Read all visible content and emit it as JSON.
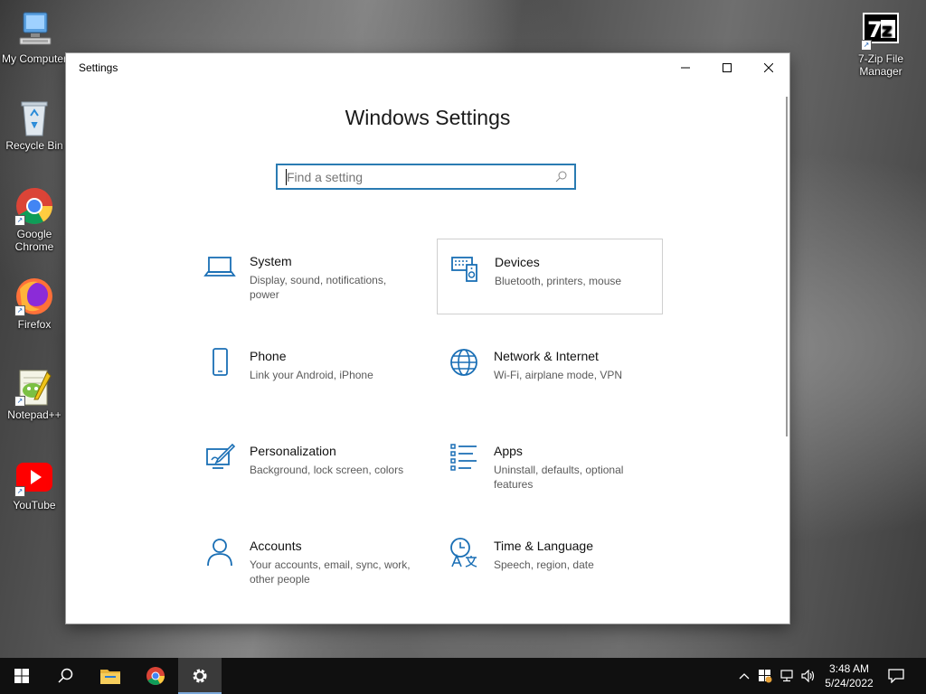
{
  "desktop": {
    "icons": [
      {
        "label": "My Computer",
        "icon": "computer-icon"
      },
      {
        "label": "Recycle Bin",
        "icon": "recycle-bin-icon"
      },
      {
        "label": "Google Chrome",
        "icon": "chrome-icon"
      },
      {
        "label": "Firefox",
        "icon": "firefox-icon"
      },
      {
        "label": "Notepad++",
        "icon": "notepadpp-icon"
      },
      {
        "label": "YouTube",
        "icon": "youtube-icon"
      },
      {
        "label": "7-Zip File Manager",
        "icon": "7zip-icon"
      }
    ]
  },
  "window": {
    "title": "Settings",
    "heading": "Windows Settings",
    "search_placeholder": "Find a setting",
    "tiles": [
      {
        "name": "System",
        "desc": "Display, sound, notifications, power",
        "icon": "laptop-icon"
      },
      {
        "name": "Devices",
        "desc": "Bluetooth, printers, mouse",
        "icon": "devices-icon"
      },
      {
        "name": "Phone",
        "desc": "Link your Android, iPhone",
        "icon": "phone-icon"
      },
      {
        "name": "Network & Internet",
        "desc": "Wi-Fi, airplane mode, VPN",
        "icon": "globe-icon"
      },
      {
        "name": "Personalization",
        "desc": "Background, lock screen, colors",
        "icon": "personalization-icon"
      },
      {
        "name": "Apps",
        "desc": "Uninstall, defaults, optional features",
        "icon": "apps-icon"
      },
      {
        "name": "Accounts",
        "desc": "Your accounts, email, sync, work, other people",
        "icon": "person-icon"
      },
      {
        "name": "Time & Language",
        "desc": "Speech, region, date",
        "icon": "time-language-icon"
      }
    ]
  },
  "taskbar": {
    "time": "3:48 AM",
    "date": "5/24/2022"
  },
  "colors": {
    "accent": "#1a6fb5",
    "search_border": "#2a7bb2",
    "taskbar": "#101010"
  }
}
